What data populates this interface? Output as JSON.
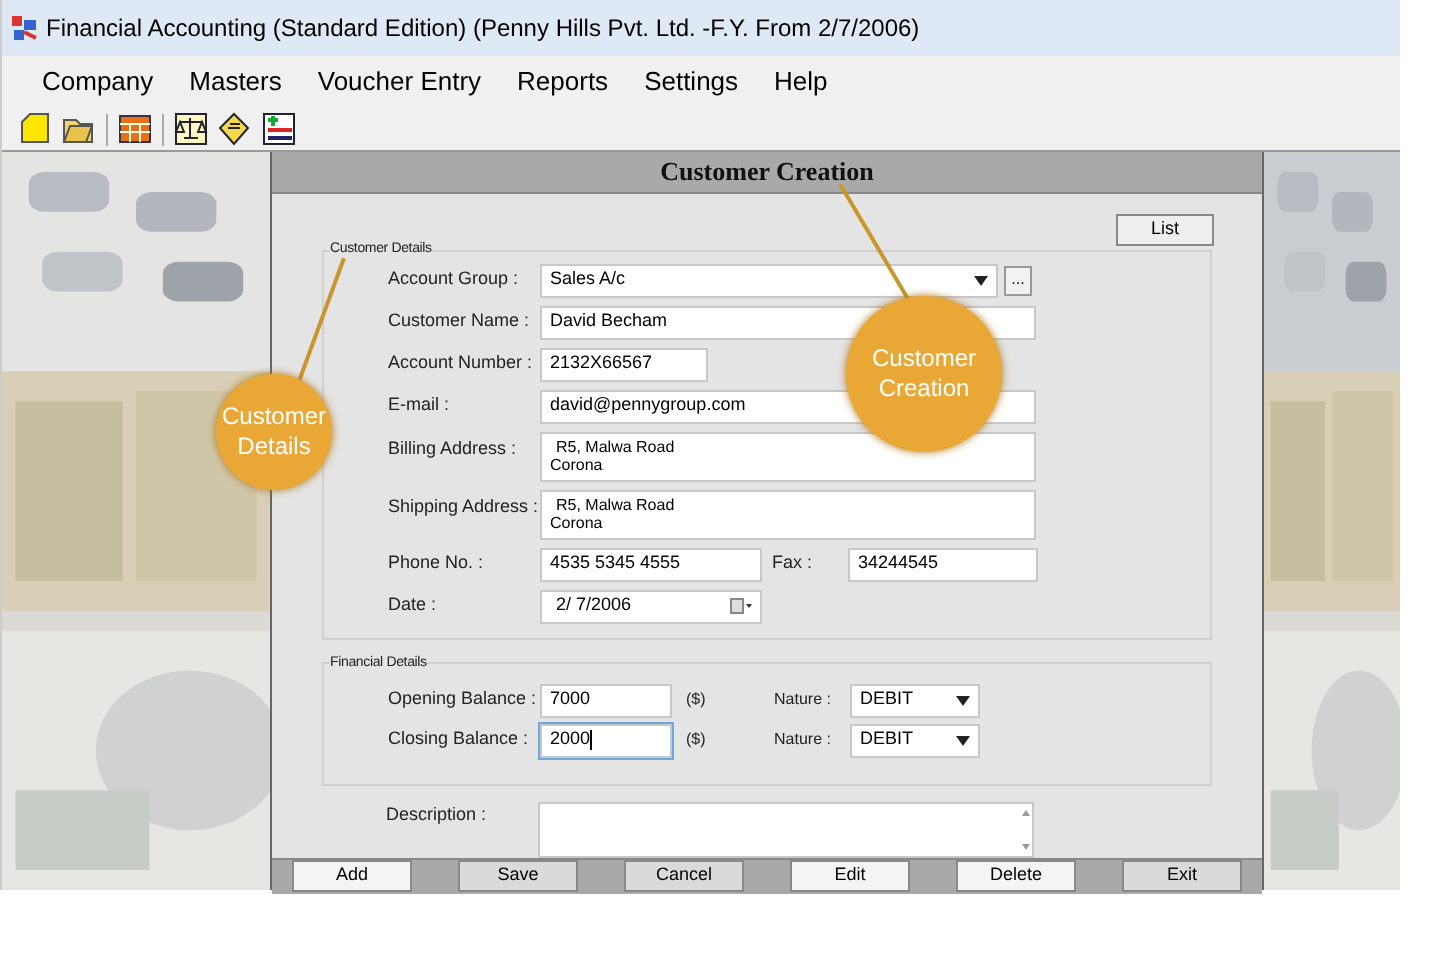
{
  "window": {
    "title": "Financial Accounting (Standard Edition) (Penny Hills Pvt. Ltd. -F.Y. From 2/7/2006)"
  },
  "menu": [
    "Company",
    "Masters",
    "Voucher Entry",
    "Reports",
    "Settings",
    "Help"
  ],
  "form": {
    "title": "Customer Creation",
    "list_button": "List",
    "customer_details": {
      "legend": "Customer Details",
      "fields": [
        {
          "kind": "select",
          "label": "Account Group :",
          "value": "Sales A/c",
          "more": "..."
        },
        {
          "kind": "text",
          "label": "Customer Name :",
          "value": "David Becham"
        },
        {
          "kind": "short",
          "label": "Account Number :",
          "value": "2132X66567"
        },
        {
          "kind": "text",
          "label": "E-mail :",
          "value": "david@pennygroup.com"
        },
        {
          "kind": "multiline",
          "label": "Billing Address :",
          "value": "R5, Malwa Road",
          "value_2": "Corona"
        },
        {
          "kind": "multiline",
          "label": "Shipping Address :",
          "value": "R5, Malwa Road",
          "value_2": "Corona"
        },
        {
          "kind": "pair",
          "label": "Phone No. :",
          "value": "4535 5345 4555",
          "extra_label": "Fax :",
          "extra_value": "34244545"
        },
        {
          "kind": "date",
          "label": "Date :",
          "value": "2/ 7/2006"
        }
      ]
    },
    "financial_details": {
      "legend": "Financial Details",
      "rows": [
        {
          "label": "Opening Balance :",
          "value": "7000",
          "unit": "($)",
          "nature_label": "Nature :",
          "nature": "DEBIT",
          "focused": false
        },
        {
          "label": "Closing Balance :",
          "value": "2000",
          "unit": "($)",
          "nature_label": "Nature :",
          "nature": "DEBIT",
          "focused": true
        }
      ]
    },
    "description": {
      "label": "Description :"
    },
    "buttons": [
      {
        "label": "Add",
        "selected": true
      },
      {
        "label": "Save",
        "selected": false
      },
      {
        "label": "Cancel",
        "selected": false
      },
      {
        "label": "Edit",
        "selected": true
      },
      {
        "label": "Delete",
        "selected": true
      },
      {
        "label": "Exit",
        "selected": false
      }
    ]
  },
  "callouts": [
    {
      "text": "Customer Details"
    },
    {
      "text": "Customer Creation"
    }
  ]
}
